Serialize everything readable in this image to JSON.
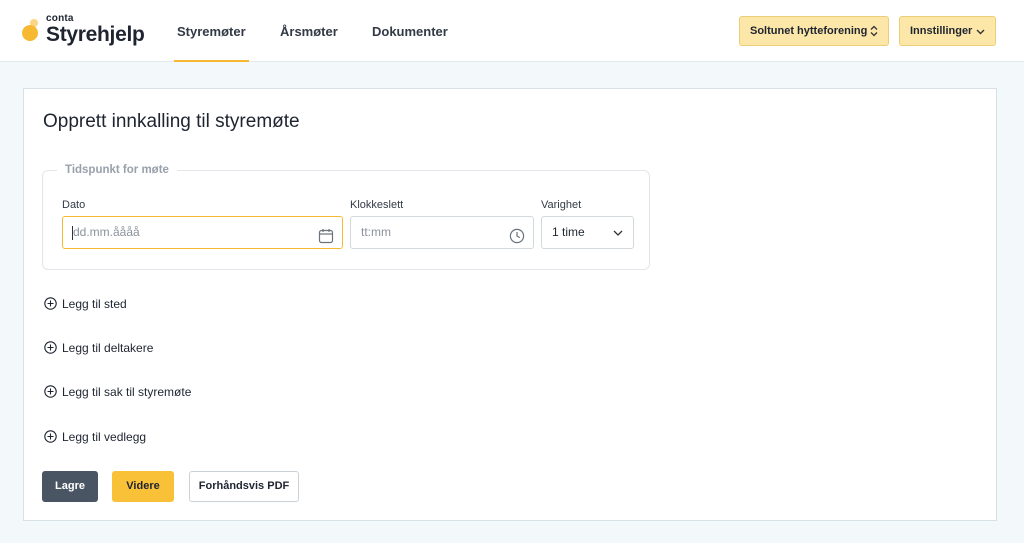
{
  "header": {
    "logo": {
      "brand": "conta",
      "name": "Styrehjelp"
    },
    "nav": [
      {
        "label": "Styremøter",
        "active": true
      },
      {
        "label": "Årsmøter",
        "active": false
      },
      {
        "label": "Dokumenter",
        "active": false
      }
    ],
    "org_select": {
      "label": "Soltunet hytteforening",
      "icon": "updown-chevron-icon"
    },
    "settings": {
      "label": "Innstillinger",
      "icon": "chevron-down-icon"
    }
  },
  "form": {
    "title": "Opprett innkalling til styremøte",
    "time_group": {
      "legend": "Tidspunkt for møte",
      "date": {
        "label": "Dato",
        "placeholder": "dd.mm.åååå",
        "icon": "calendar-icon"
      },
      "time": {
        "label": "Klokkeslett",
        "placeholder": "tt:mm",
        "icon": "clock-icon"
      },
      "duration": {
        "label": "Varighet",
        "value": "1 time",
        "icon": "chevron-down-icon"
      }
    },
    "add_actions": [
      "Legg til sted",
      "Legg til deltakere",
      "Legg til sak til styremøte",
      "Legg til vedlegg"
    ],
    "buttons": {
      "save": "Lagre",
      "next": "Videre",
      "preview_pdf": "Forhåndsvis PDF"
    }
  },
  "colors": {
    "accent": "#f8b932",
    "header_button_bg": "#fce7a9",
    "dark_button": "#4a5564",
    "page_bg": "#f3f8fb"
  }
}
